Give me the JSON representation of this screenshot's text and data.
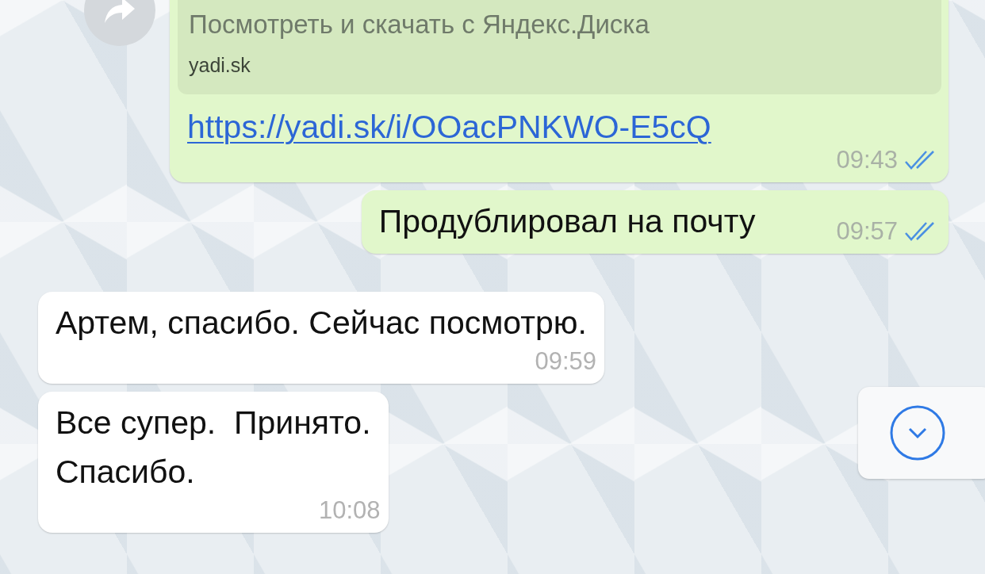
{
  "messages": [
    {
      "kind": "link",
      "outgoing": true,
      "preview_title": "Посмотреть и скачать с Яндекс.Диска",
      "preview_domain": "yadi.sk",
      "link": "https://yadi.sk/i/OOacPNKWO-E5cQ",
      "time": "09:43",
      "read": true
    },
    {
      "kind": "text",
      "outgoing": true,
      "text": "Продублировал на почту",
      "time": "09:57",
      "read": true
    },
    {
      "kind": "text",
      "outgoing": false,
      "text": "Артем, спасибо. Сейчас посмотрю.",
      "time": "09:59"
    },
    {
      "kind": "text",
      "outgoing": false,
      "text": "Все супер.  Принято.\nСпасибо.",
      "time": "10:08"
    }
  ]
}
